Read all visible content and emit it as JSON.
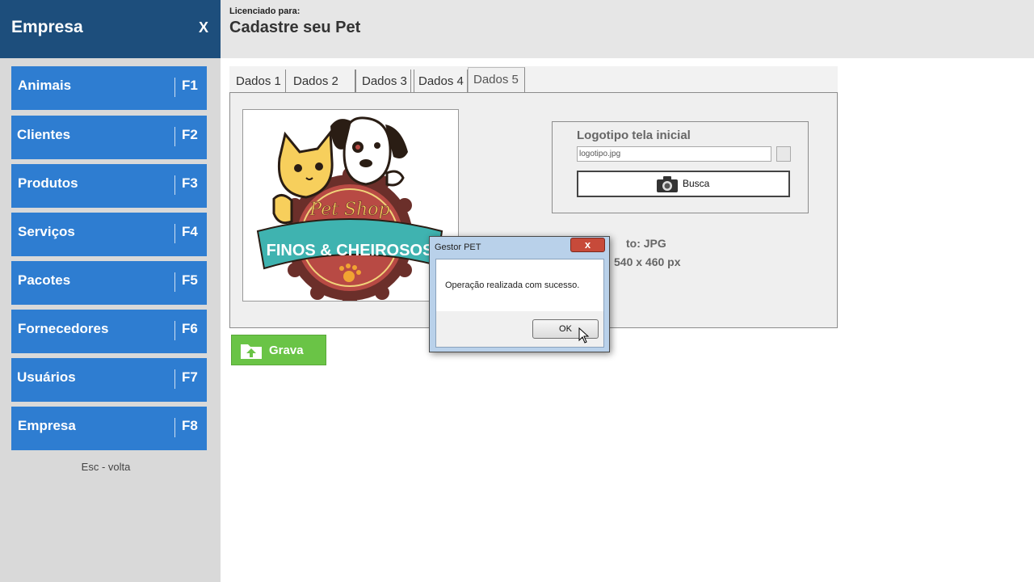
{
  "sidebar": {
    "title": "Empresa",
    "close": "X",
    "items": [
      {
        "label": "Animais",
        "key": "F1"
      },
      {
        "label": "Clientes",
        "key": "F2"
      },
      {
        "label": "Produtos",
        "key": "F3"
      },
      {
        "label": "Serviços",
        "key": "F4"
      },
      {
        "label": "Pacotes",
        "key": "F5"
      },
      {
        "label": "Fornecedores",
        "key": "F6"
      },
      {
        "label": "Usuários",
        "key": "F7"
      },
      {
        "label": "Empresa",
        "key": "F8"
      }
    ],
    "esc_hint": "Esc - volta"
  },
  "header": {
    "license_label": "Licenciado para:",
    "title": "Cadastre seu Pet"
  },
  "tabs": [
    {
      "label": "Dados 1"
    },
    {
      "label": "Dados 2"
    },
    {
      "label": "Dados 3"
    },
    {
      "label": "Dados 4"
    },
    {
      "label": "Dados 5",
      "active": true
    }
  ],
  "logo_image": {
    "brand_top": "Pet Shop",
    "brand_banner": "FINOS & CHEIROSOS"
  },
  "logo_group": {
    "title": "Logotipo tela inicial",
    "file_value": "logotipo.jpg",
    "busca_label": "Busca"
  },
  "info": {
    "format": "to:  JPG",
    "size": "540 x  460 px"
  },
  "grava": {
    "label": "Grava"
  },
  "dialog": {
    "title": "Gestor PET",
    "close": "x",
    "message": "Operação realizada com sucesso.",
    "ok_label": "OK"
  },
  "colors": {
    "sidebar_header": "#1d4e7c",
    "menu_item": "#2e7dd1",
    "grava": "#6ac446",
    "dialog_frame": "#b9d1ea"
  }
}
